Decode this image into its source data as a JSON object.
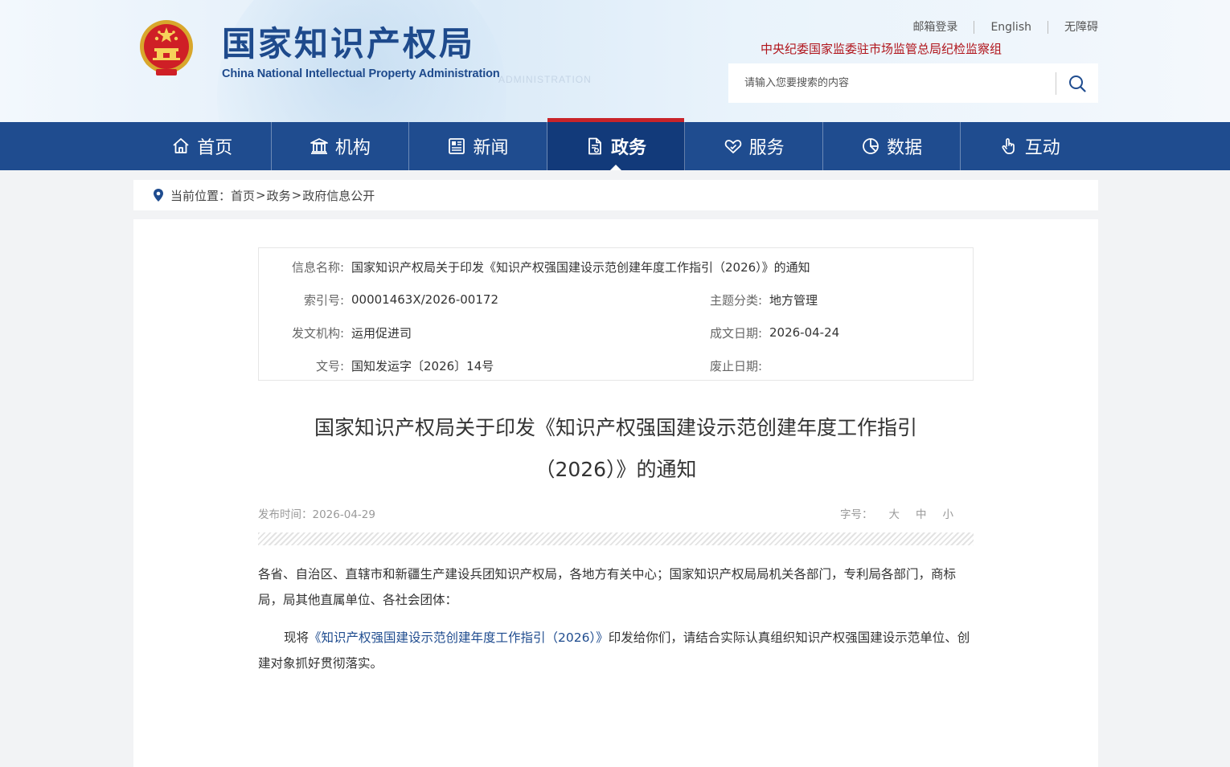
{
  "header": {
    "logo_cn": "国家知识产权局",
    "logo_en": "China National Intellectual Property Administration",
    "watermark": "ADMINISTRATION",
    "top_links": [
      "邮箱登录",
      "English",
      "无障碍"
    ],
    "inspection_link": "中央纪委国家监委驻市场监管总局纪检监察组",
    "search": {
      "placeholder": "请输入您要搜索的内容",
      "icon": "search-icon"
    }
  },
  "nav": {
    "items": [
      {
        "label": "首页",
        "icon": "home-icon"
      },
      {
        "label": "机构",
        "icon": "institution-icon"
      },
      {
        "label": "新闻",
        "icon": "newspaper-icon"
      },
      {
        "label": "政务",
        "icon": "document-icon",
        "active": true
      },
      {
        "label": "服务",
        "icon": "heart-hand-icon"
      },
      {
        "label": "数据",
        "icon": "pie-chart-icon"
      },
      {
        "label": "互动",
        "icon": "hand-pointer-icon"
      }
    ]
  },
  "breadcrumb": {
    "prefix": "当前位置：",
    "items": [
      "首页",
      "政务",
      "政府信息公开"
    ],
    "separator": ">"
  },
  "meta": {
    "name_label": "信息名称:",
    "name_value": "国家知识产权局关于印发《知识产权强国建设示范创建年度工作指引（2026）》的通知",
    "index_label": "索引号:",
    "index_value": "00001463X/2026-00172",
    "topic_label": "主题分类:",
    "topic_value": "地方管理",
    "issuer_label": "发文机构:",
    "issuer_value": "运用促进司",
    "date_label": "成文日期:",
    "date_value": "2026-04-24",
    "docno_label": "文号:",
    "docno_value": "国知发运字〔2026〕14号",
    "expiry_label": "废止日期:",
    "expiry_value": ""
  },
  "article": {
    "title_line1": "国家知识产权局关于印发《知识产权强国建设示范创建年度工作指引",
    "title_line2": "（2026）》的通知",
    "publish_label": "发布时间：",
    "publish_date": "2026-04-29",
    "font_size_label": "字号：",
    "font_sizes": [
      "大",
      "中",
      "小"
    ],
    "para1": "各省、自治区、直辖市和新疆生产建设兵团知识产权局，各地方有关中心；国家知识产权局局机关各部门，专利局各部门，商标局，局其他直属单位、各社会团体：",
    "para2_prefix": "现将",
    "para2_link": "《知识产权强国建设示范创建年度工作指引（2026）》",
    "para2_suffix": "印发给你们，请结合实际认真组织知识产权强国建设示范单位、创建对象抓好贯彻落实。"
  },
  "colors": {
    "nav_bg": "#1f4c8f",
    "nav_active": "#123a7a",
    "accent_red": "#c8242a",
    "logo_blue": "#1e4a8c"
  }
}
